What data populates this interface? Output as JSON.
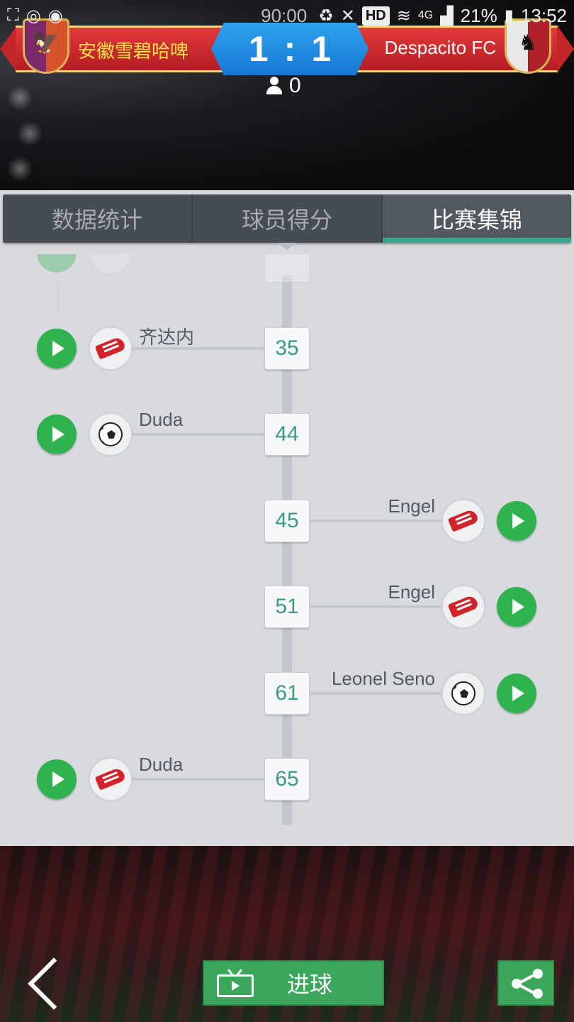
{
  "status_bar": {
    "game_time": "90:00",
    "hd": "HD",
    "network": "4G",
    "battery": "21%",
    "clock": "13:52"
  },
  "match": {
    "home_team": "安徽雪碧哈啤",
    "away_team": "Despacito FC",
    "home_score": "1",
    "separator": ":",
    "away_score": "1",
    "viewers": "0"
  },
  "tabs": [
    {
      "label": "数据统计",
      "active": false
    },
    {
      "label": "球员得分",
      "active": false
    },
    {
      "label": "比赛集锦",
      "active": true
    }
  ],
  "events": [
    {
      "minute": "35",
      "side": "home",
      "type": "assist",
      "icon": "boot-icon",
      "player": "齐达内"
    },
    {
      "minute": "44",
      "side": "home",
      "type": "goal",
      "icon": "ball-icon",
      "player": "Duda"
    },
    {
      "minute": "45",
      "side": "away",
      "type": "assist",
      "icon": "boot-icon",
      "player": "Engel"
    },
    {
      "minute": "51",
      "side": "away",
      "type": "assist",
      "icon": "boot-icon",
      "player": "Engel"
    },
    {
      "minute": "61",
      "side": "away",
      "type": "goal",
      "icon": "ball-icon",
      "player": "Leonel Seno"
    },
    {
      "minute": "65",
      "side": "home",
      "type": "assist",
      "icon": "boot-icon",
      "player": "Duda"
    }
  ],
  "footer": {
    "goal_button_label": "进球",
    "colors": {
      "accent_green": "#3aa75a",
      "minute_teal": "#3a9a82",
      "banner_red": "#c4252b",
      "score_blue": "#1e8be0"
    }
  }
}
